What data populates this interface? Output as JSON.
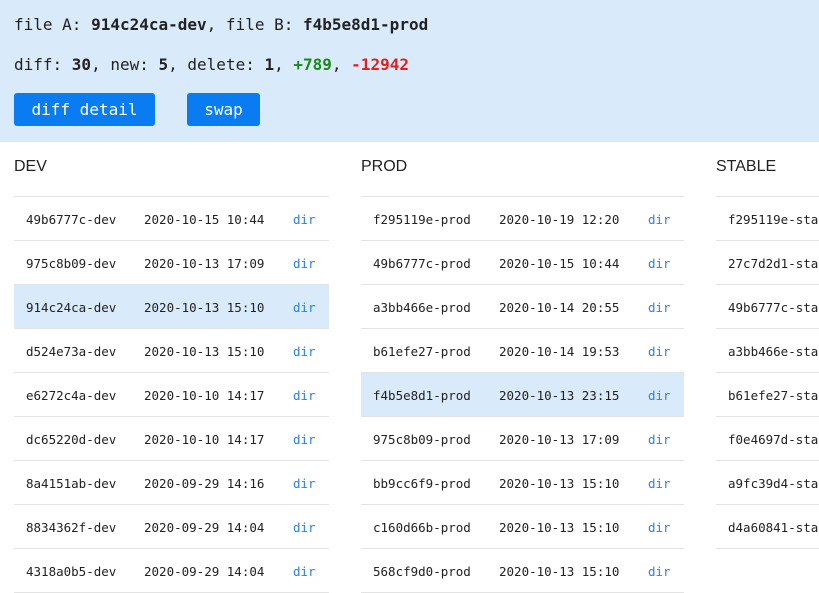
{
  "summary": {
    "file_a_label": "file A: ",
    "file_a": "914c24ca-dev",
    "file_b_label": ", file B: ",
    "file_b": "f4b5e8d1-prod",
    "diff_label": "diff: ",
    "diff": "30",
    "new_label": ", new: ",
    "new": "5",
    "delete_label": ", delete: ",
    "delete": "1",
    "sep": ", ",
    "added": "+789",
    "removed": "-12942"
  },
  "buttons": {
    "diff_detail": "diff detail",
    "swap": "swap"
  },
  "columns": [
    {
      "title": "DEV",
      "rows": [
        {
          "id": "49b6777c-dev",
          "time": "2020-10-15 10:44",
          "link": "dir",
          "selected": false
        },
        {
          "id": "975c8b09-dev",
          "time": "2020-10-13 17:09",
          "link": "dir",
          "selected": false
        },
        {
          "id": "914c24ca-dev",
          "time": "2020-10-13 15:10",
          "link": "dir",
          "selected": true
        },
        {
          "id": "d524e73a-dev",
          "time": "2020-10-13 15:10",
          "link": "dir",
          "selected": false
        },
        {
          "id": "e6272c4a-dev",
          "time": "2020-10-10 14:17",
          "link": "dir",
          "selected": false
        },
        {
          "id": "dc65220d-dev",
          "time": "2020-10-10 14:17",
          "link": "dir",
          "selected": false
        },
        {
          "id": "8a4151ab-dev",
          "time": "2020-09-29 14:16",
          "link": "dir",
          "selected": false
        },
        {
          "id": "8834362f-dev",
          "time": "2020-09-29 14:04",
          "link": "dir",
          "selected": false
        },
        {
          "id": "4318a0b5-dev",
          "time": "2020-09-29 14:04",
          "link": "dir",
          "selected": false
        }
      ]
    },
    {
      "title": "PROD",
      "rows": [
        {
          "id": "f295119e-prod",
          "time": "2020-10-19 12:20",
          "link": "dir",
          "selected": false
        },
        {
          "id": "49b6777c-prod",
          "time": "2020-10-15 10:44",
          "link": "dir",
          "selected": false
        },
        {
          "id": "a3bb466e-prod",
          "time": "2020-10-14 20:55",
          "link": "dir",
          "selected": false
        },
        {
          "id": "b61efe27-prod",
          "time": "2020-10-14 19:53",
          "link": "dir",
          "selected": false
        },
        {
          "id": "f4b5e8d1-prod",
          "time": "2020-10-13 23:15",
          "link": "dir",
          "selected": true
        },
        {
          "id": "975c8b09-prod",
          "time": "2020-10-13 17:09",
          "link": "dir",
          "selected": false
        },
        {
          "id": "bb9cc6f9-prod",
          "time": "2020-10-13 15:10",
          "link": "dir",
          "selected": false
        },
        {
          "id": "c160d66b-prod",
          "time": "2020-10-13 15:10",
          "link": "dir",
          "selected": false
        },
        {
          "id": "568cf9d0-prod",
          "time": "2020-10-13 15:10",
          "link": "dir",
          "selected": false
        }
      ]
    },
    {
      "title": "STABLE",
      "rows": [
        {
          "id": "f295119e-sta",
          "time": "",
          "link": "",
          "selected": false
        },
        {
          "id": "27c7d2d1-sta",
          "time": "",
          "link": "",
          "selected": false
        },
        {
          "id": "49b6777c-sta",
          "time": "",
          "link": "",
          "selected": false
        },
        {
          "id": "a3bb466e-sta",
          "time": "",
          "link": "",
          "selected": false
        },
        {
          "id": "b61efe27-sta",
          "time": "",
          "link": "",
          "selected": false
        },
        {
          "id": "f0e4697d-sta",
          "time": "",
          "link": "",
          "selected": false
        },
        {
          "id": "a9fc39d4-sta",
          "time": "",
          "link": "",
          "selected": false
        },
        {
          "id": "d4a60841-sta",
          "time": "",
          "link": "",
          "selected": false
        }
      ]
    }
  ]
}
